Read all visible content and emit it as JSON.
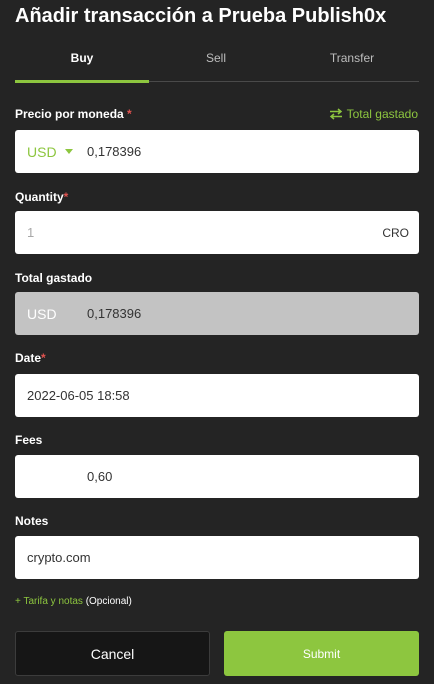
{
  "title": "Añadir transacción a Prueba Publish0x",
  "tabs": [
    {
      "label": "Buy",
      "active": true
    },
    {
      "label": "Sell",
      "active": false
    },
    {
      "label": "Transfer",
      "active": false
    }
  ],
  "price": {
    "label": "Precio por moneda",
    "required_mark": "*",
    "toggle_label": "Total gastado",
    "currency": "USD",
    "value": "0,178396"
  },
  "quantity": {
    "label": "Quantity",
    "required_mark": "*",
    "placeholder": "1",
    "unit": "CRO"
  },
  "total": {
    "label": "Total gastado",
    "currency": "USD",
    "value": "0,178396"
  },
  "date": {
    "label": "Date",
    "required_mark": "*",
    "value": "2022-06-05 18:58"
  },
  "fees": {
    "label": "Fees",
    "value": "0,60"
  },
  "notes": {
    "label": "Notes",
    "value": "crypto.com"
  },
  "optional_link": {
    "prefix": "+ Tarifa y notas",
    "suffix": "(Opcional)"
  },
  "buttons": {
    "cancel": "Cancel",
    "submit": "Submit"
  },
  "colors": {
    "accent": "#8dc63f",
    "background": "#242424",
    "required": "#e0524f"
  }
}
